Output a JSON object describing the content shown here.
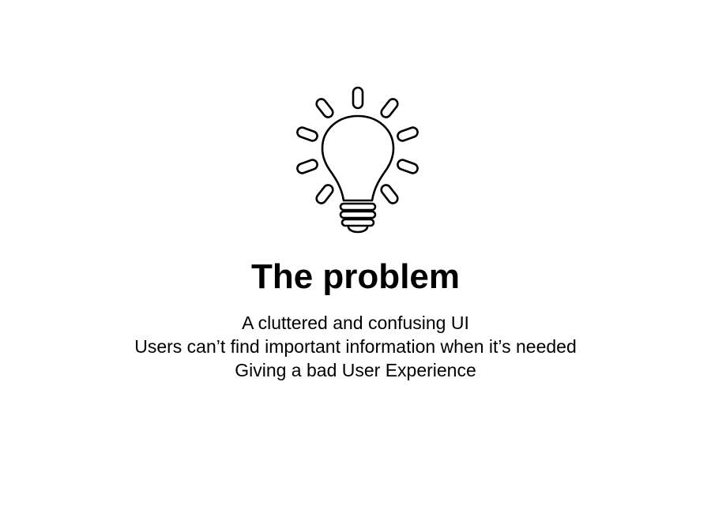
{
  "slide": {
    "icon": "lightbulb-icon",
    "title": "The problem",
    "lines": [
      "A cluttered and confusing UI",
      "Users can’t find important information when it’s needed",
      "Giving a bad User Experience"
    ],
    "colors": {
      "background": "#ffffff",
      "text": "#000000",
      "icon_stroke": "#000000"
    }
  }
}
